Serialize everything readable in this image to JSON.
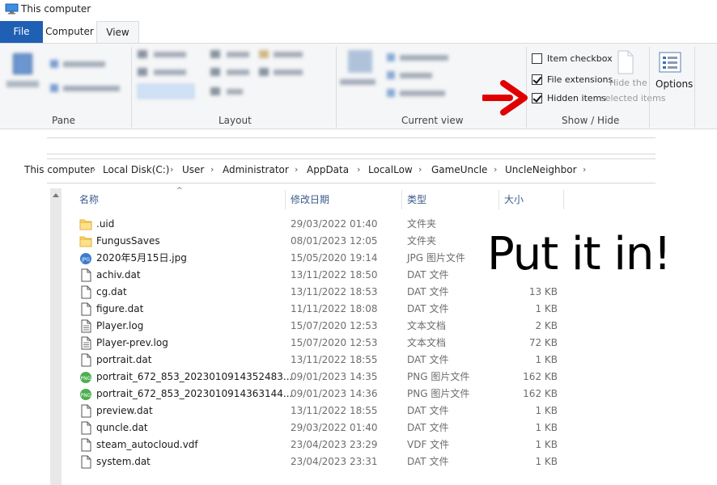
{
  "window": {
    "title": "This computer"
  },
  "tabs": [
    "File",
    "Computer",
    "View"
  ],
  "ribbon": {
    "groups": [
      "Pane",
      "Layout",
      "Current view",
      "Show / Hide"
    ],
    "show_hide": {
      "item_checkboxes": {
        "label": "Item checkbox",
        "checked": false
      },
      "file_extensions": {
        "label": "File extensions",
        "checked": true
      },
      "hidden_items": {
        "label": "Hidden items",
        "checked": true
      },
      "hide_selected": [
        "Hide the",
        "selected items"
      ]
    },
    "options_label": "Options"
  },
  "annotation": {
    "text": "Put it in!",
    "arrow_color": "#e10000"
  },
  "breadcrumb": [
    "This computer",
    "Local Disk(C:)",
    "User",
    "Administrator",
    "AppData",
    "LocalLow",
    "GameUncle",
    "UncleNeighbor"
  ],
  "columns": {
    "name": "名称",
    "date": "修改日期",
    "type": "类型",
    "size": "大小"
  },
  "files": [
    {
      "name": ".uid",
      "date": "29/03/2022 01:40",
      "type": "文件夹",
      "size": "",
      "icon": "folder"
    },
    {
      "name": "FungusSaves",
      "date": "08/01/2023 12:05",
      "type": "文件夹",
      "size": "",
      "icon": "folder"
    },
    {
      "name": "2020年5月15日.jpg",
      "date": "15/05/2020 19:14",
      "type": "JPG 图片文件",
      "size": "",
      "icon": "jpg"
    },
    {
      "name": "achiv.dat",
      "date": "13/11/2022 18:50",
      "type": "DAT 文件",
      "size": "",
      "icon": "file"
    },
    {
      "name": "cg.dat",
      "date": "13/11/2022 18:53",
      "type": "DAT 文件",
      "size": "13 KB",
      "icon": "file"
    },
    {
      "name": "figure.dat",
      "date": "11/11/2022 18:08",
      "type": "DAT 文件",
      "size": "1 KB",
      "icon": "file"
    },
    {
      "name": "Player.log",
      "date": "15/07/2020 12:53",
      "type": "文本文档",
      "size": "2 KB",
      "icon": "text"
    },
    {
      "name": "Player-prev.log",
      "date": "15/07/2020 12:53",
      "type": "文本文档",
      "size": "72 KB",
      "icon": "text"
    },
    {
      "name": "portrait.dat",
      "date": "13/11/2022 18:55",
      "type": "DAT 文件",
      "size": "1 KB",
      "icon": "file"
    },
    {
      "name": "portrait_672_853_2023010914352483...",
      "date": "09/01/2023 14:35",
      "type": "PNG 图片文件",
      "size": "162 KB",
      "icon": "png"
    },
    {
      "name": "portrait_672_853_2023010914363144...",
      "date": "09/01/2023 14:36",
      "type": "PNG 图片文件",
      "size": "162 KB",
      "icon": "png"
    },
    {
      "name": "preview.dat",
      "date": "13/11/2022 18:55",
      "type": "DAT 文件",
      "size": "1 KB",
      "icon": "file"
    },
    {
      "name": "quncle.dat",
      "date": "29/03/2022 01:40",
      "type": "DAT 文件",
      "size": "1 KB",
      "icon": "file"
    },
    {
      "name": "steam_autocloud.vdf",
      "date": "23/04/2023 23:29",
      "type": "VDF 文件",
      "size": "1 KB",
      "icon": "file"
    },
    {
      "name": "system.dat",
      "date": "23/04/2023 23:31",
      "type": "DAT 文件",
      "size": "1 KB",
      "icon": "file"
    }
  ]
}
